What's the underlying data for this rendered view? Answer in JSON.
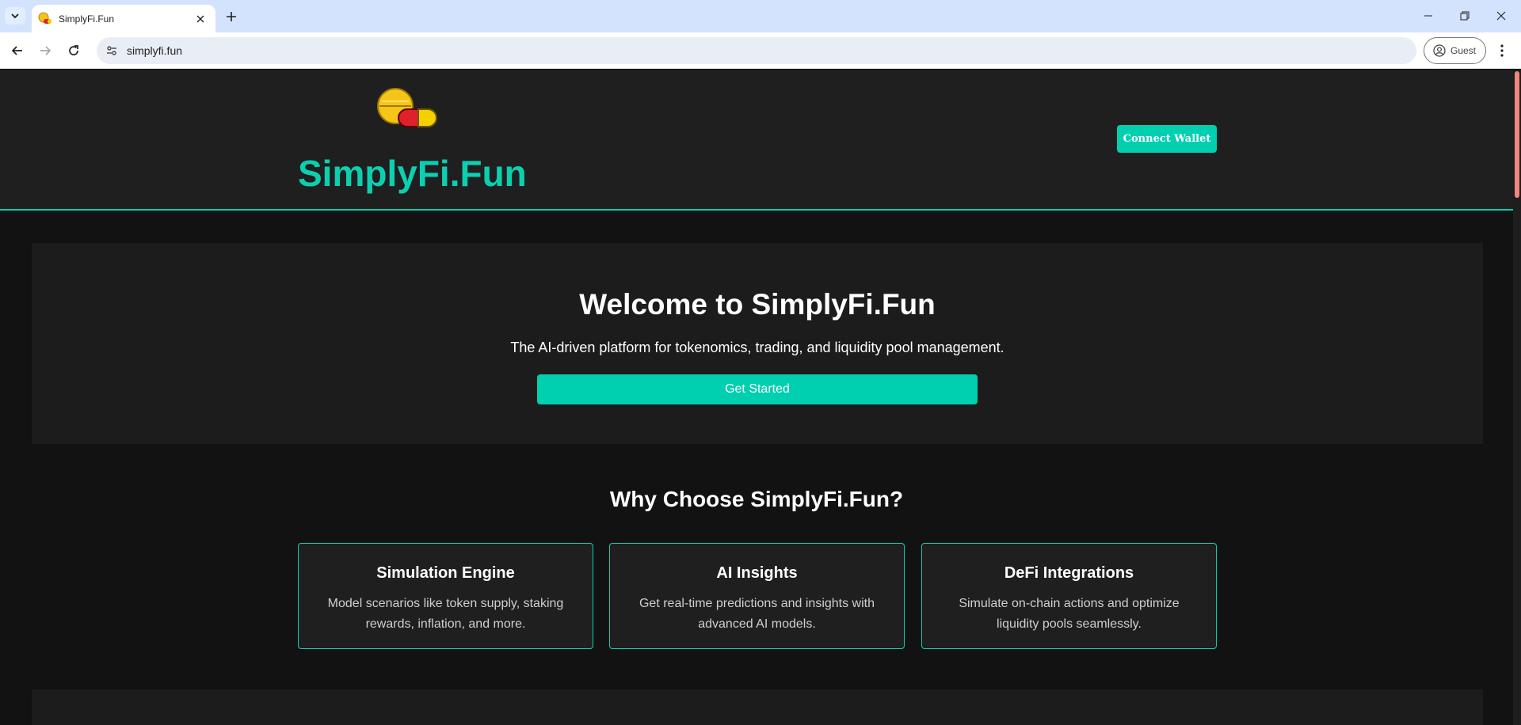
{
  "browser": {
    "tab_title": "SimplyFi.Fun",
    "url": "simplyfi.fun",
    "profile_label": "Guest"
  },
  "header": {
    "brand": "SimplyFi.Fun",
    "connect_label": "Connect Wallet"
  },
  "hero": {
    "title": "Welcome to SimplyFi.Fun",
    "subtitle": "The AI-driven platform for tokenomics, trading, and liquidity pool management.",
    "cta_label": "Get Started"
  },
  "features": {
    "heading": "Why Choose SimplyFi.Fun?",
    "items": [
      {
        "title": "Simulation Engine",
        "description": "Model scenarios like token supply, staking rewards, inflation, and more."
      },
      {
        "title": "AI Insights",
        "description": "Get real-time predictions and insights with advanced AI models."
      },
      {
        "title": "DeFi Integrations",
        "description": "Simulate on-chain actions and optimize liquidity pools seamlessly."
      }
    ]
  },
  "colors": {
    "accent": "#00cfb0",
    "header_bg": "#1f1f1f",
    "page_bg": "#121212",
    "chrome_tabbar": "#d3e3fd"
  },
  "icons": [
    "tab-list-icon",
    "pill-coin-logo-icon",
    "close-icon",
    "plus-icon",
    "minimize-icon",
    "restore-icon",
    "back-icon",
    "forward-icon",
    "reload-icon",
    "site-info-icon",
    "profile-icon",
    "kebab-menu-icon"
  ]
}
